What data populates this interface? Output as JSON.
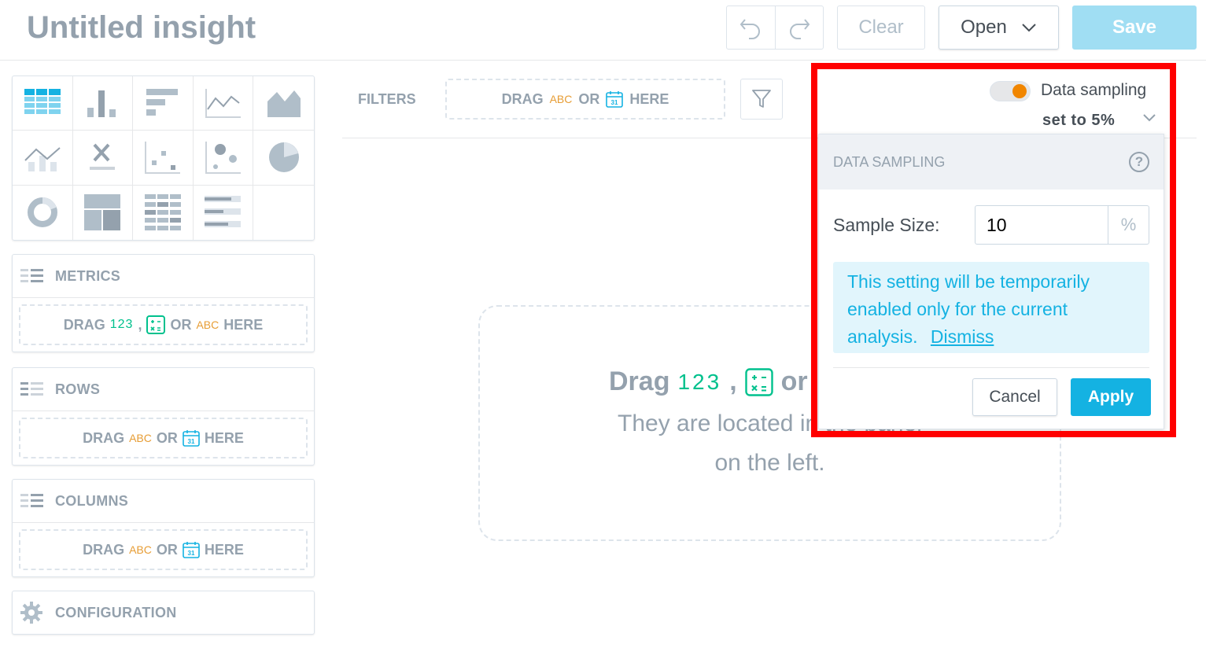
{
  "header": {
    "title": "Untitled insight",
    "clear_label": "Clear",
    "open_label": "Open",
    "save_label": "Save"
  },
  "buckets": {
    "metrics": {
      "title": "METRICS",
      "drop": {
        "drag": "DRAG",
        "n123": "123",
        "comma": ",",
        "or": "OR",
        "abc": "ABC",
        "here": "HERE"
      }
    },
    "rows": {
      "title": "ROWS",
      "drop": {
        "drag": "DRAG",
        "abc": "ABC",
        "or": "OR",
        "here": "HERE"
      }
    },
    "columns": {
      "title": "COLUMNS",
      "drop": {
        "drag": "DRAG",
        "abc": "ABC",
        "or": "OR",
        "here": "HERE"
      }
    },
    "configuration": {
      "title": "CONFIGURATION"
    }
  },
  "filters": {
    "label": "FILTERS",
    "drop": {
      "drag": "DRAG",
      "abc": "ABC",
      "or": "OR",
      "here": "HERE"
    }
  },
  "canvas": {
    "line1_drag": "Drag",
    "line1_123": "123",
    "line1_comma": ",",
    "line1_or": "or",
    "line2": "They are located in the panel",
    "line3": "on the left."
  },
  "sampling": {
    "toggle_label": "Data sampling",
    "toggle_on": true,
    "current_value": "set to 5%",
    "popup_title": "DATA SAMPLING",
    "help_glyph": "?",
    "sample_size_label": "Sample Size:",
    "sample_size_value": "10",
    "unit": "%",
    "info_text": "This setting will be temporarily enabled only for the current analysis.",
    "dismiss_label": "Dismiss",
    "cancel_label": "Cancel",
    "apply_label": "Apply"
  },
  "colors": {
    "accent": "#14b2e2",
    "toggle_knob": "#f18600",
    "abc": "#e79d35",
    "metric": "#00c18d",
    "muted": "#94a1ad",
    "highlight": "#ff0000"
  },
  "icons": {
    "undo": "undo-icon",
    "redo": "redo-icon",
    "open_chevron": "chevron-down-icon",
    "filter": "funnel-icon",
    "calendar": "calendar-icon",
    "calculated_metric": "calculator-icon",
    "bucket_list": "list-icon",
    "configuration": "gear-icon",
    "help": "help-icon"
  }
}
